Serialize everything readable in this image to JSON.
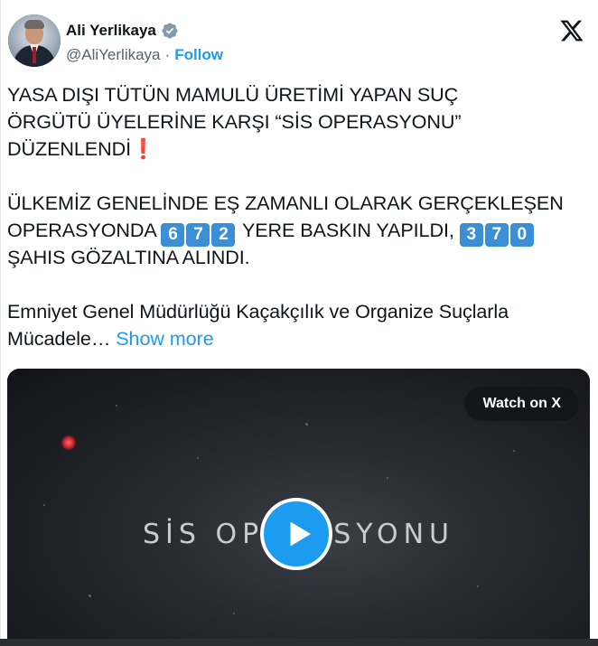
{
  "author": {
    "name": "Ali Yerlikaya",
    "handle": "@AliYerlikaya",
    "separator": "·",
    "follow_label": "Follow"
  },
  "tweet": {
    "line1": "YASA DIŞI TÜTÜN MAMULÜ ÜRETİMİ YAPAN SUÇ",
    "line2": "ÖRGÜTÜ ÜYELERİNE KARŞI “SİS OPERASYONU”",
    "line3": "DÜZENLENDİ",
    "line3_emoji": "❗",
    "line4": "ÜLKEMİZ GENELİNDE EŞ ZAMANLI OLARAK GERÇEKLEŞEN",
    "line5_a": "OPERASYONDA",
    "raid_digits": [
      "6",
      "7",
      "2"
    ],
    "line5_b": "YERE BASKIN YAPILDI,",
    "detain_digits": [
      "3",
      "7",
      "0"
    ],
    "line6": "ŞAHIS GÖZALTINA ALINDI.",
    "line7": "Emniyet Genel Müdürlüğü Kaçakçılık ve Organize Suçlarla",
    "line8": "Mücadele…",
    "show_more": "Show more"
  },
  "media": {
    "watch_label": "Watch on X",
    "video_title": "SİS OPERASYONU"
  },
  "colors": {
    "accent": "#1d9bf0",
    "keycap": "#3b8fd4",
    "exclamation": "#d62b3b"
  },
  "icons": [
    "verified-badge-icon",
    "x-logo-icon",
    "play-icon"
  ]
}
